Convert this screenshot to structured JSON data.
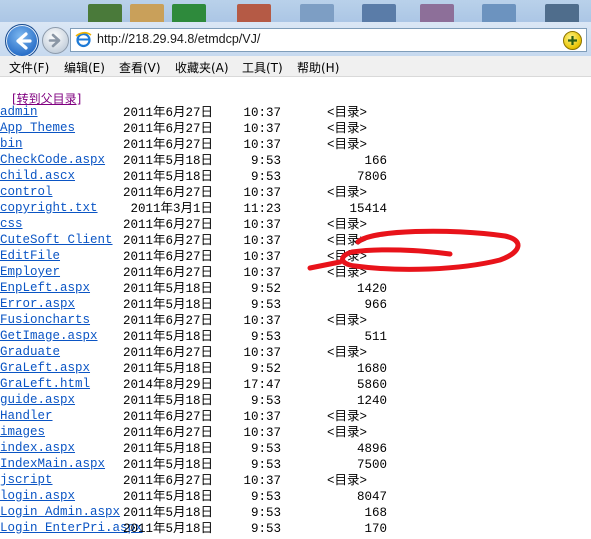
{
  "address": {
    "url": "http://218.29.94.8/etmdcp/VJ/"
  },
  "menu": [
    {
      "label": "文件(F)"
    },
    {
      "label": "编辑(E)"
    },
    {
      "label": "查看(V)"
    },
    {
      "label": "收藏夹(A)"
    },
    {
      "label": "工具(T)"
    },
    {
      "label": "帮助(H)"
    }
  ],
  "listing": {
    "parent_link": "[转到父目录]",
    "dir_marker": "<目录>",
    "rows": [
      {
        "date": "2011年6月27日",
        "time": "10:37",
        "size": "<目录>",
        "name": "admin",
        "is_dir": true
      },
      {
        "date": "2011年6月27日",
        "time": "10:37",
        "size": "<目录>",
        "name": "App_Themes",
        "is_dir": true
      },
      {
        "date": "2011年6月27日",
        "time": "10:37",
        "size": "<目录>",
        "name": "bin",
        "is_dir": true
      },
      {
        "date": "2011年5月18日",
        "time": "9:53",
        "size": "166",
        "name": "CheckCode.aspx",
        "is_dir": false
      },
      {
        "date": "2011年5月18日",
        "time": "9:53",
        "size": "7806",
        "name": "child.ascx",
        "is_dir": false
      },
      {
        "date": "2011年6月27日",
        "time": "10:37",
        "size": "<目录>",
        "name": "control",
        "is_dir": true
      },
      {
        "date": "2011年3月1日",
        "time": "11:23",
        "size": "15414",
        "name": "copyright.txt",
        "is_dir": false
      },
      {
        "date": "2011年6月27日",
        "time": "10:37",
        "size": "<目录>",
        "name": "css",
        "is_dir": true
      },
      {
        "date": "2011年6月27日",
        "time": "10:37",
        "size": "<目录>",
        "name": "CuteSoft_Client",
        "is_dir": true
      },
      {
        "date": "2011年6月27日",
        "time": "10:37",
        "size": "<目录>",
        "name": "EditFile",
        "is_dir": true
      },
      {
        "date": "2011年6月27日",
        "time": "10:37",
        "size": "<目录>",
        "name": "Employer",
        "is_dir": true
      },
      {
        "date": "2011年5月18日",
        "time": "9:52",
        "size": "1420",
        "name": "EnpLeft.aspx",
        "is_dir": false
      },
      {
        "date": "2011年5月18日",
        "time": "9:53",
        "size": "966",
        "name": "Error.aspx",
        "is_dir": false
      },
      {
        "date": "2011年6月27日",
        "time": "10:37",
        "size": "<目录>",
        "name": "Fusioncharts",
        "is_dir": true
      },
      {
        "date": "2011年5月18日",
        "time": "9:53",
        "size": "511",
        "name": "GetImage.aspx",
        "is_dir": false
      },
      {
        "date": "2011年6月27日",
        "time": "10:37",
        "size": "<目录>",
        "name": "Graduate",
        "is_dir": true
      },
      {
        "date": "2011年5月18日",
        "time": "9:52",
        "size": "1680",
        "name": "GraLeft.aspx",
        "is_dir": false
      },
      {
        "date": "2014年8月29日",
        "time": "17:47",
        "size": "5860",
        "name": "GraLeft.html",
        "is_dir": false
      },
      {
        "date": "2011年5月18日",
        "time": "9:53",
        "size": "1240",
        "name": "guide.aspx",
        "is_dir": false
      },
      {
        "date": "2011年6月27日",
        "time": "10:37",
        "size": "<目录>",
        "name": "Handler",
        "is_dir": true
      },
      {
        "date": "2011年6月27日",
        "time": "10:37",
        "size": "<目录>",
        "name": "images",
        "is_dir": true
      },
      {
        "date": "2011年5月18日",
        "time": "9:53",
        "size": "4896",
        "name": "index.aspx",
        "is_dir": false
      },
      {
        "date": "2011年5月18日",
        "time": "9:53",
        "size": "7500",
        "name": "IndexMain.aspx",
        "is_dir": false
      },
      {
        "date": "2011年6月27日",
        "time": "10:37",
        "size": "<目录>",
        "name": "jscript",
        "is_dir": true
      },
      {
        "date": "2011年5月18日",
        "time": "9:53",
        "size": "8047",
        "name": "login.aspx",
        "is_dir": false
      },
      {
        "date": "2011年5月18日",
        "time": "9:53",
        "size": "168",
        "name": "Login_Admin.aspx",
        "is_dir": false
      },
      {
        "date": "2011年5月18日",
        "time": "9:53",
        "size": "170",
        "name": "Login_EnterPri.aspx",
        "is_dir": false
      }
    ]
  },
  "colors": {
    "link": "#0b55c4",
    "visited": "#800080",
    "annotation": "#e8131a"
  }
}
